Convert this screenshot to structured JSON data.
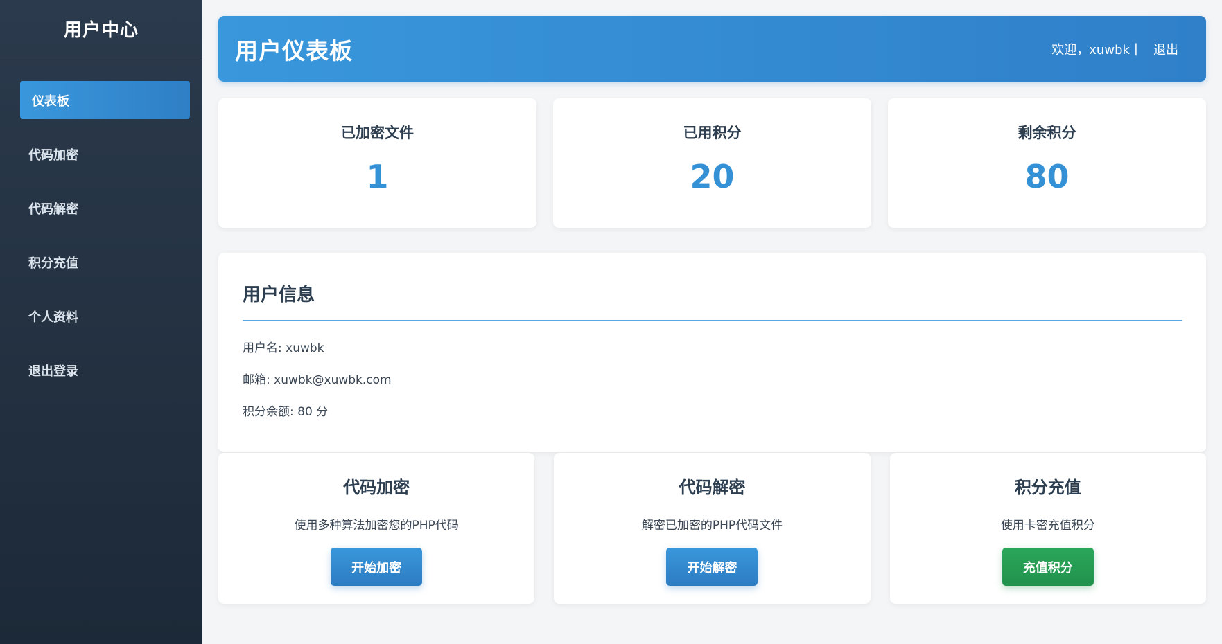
{
  "sidebar": {
    "title": "用户中心",
    "items": [
      {
        "label": "仪表板",
        "active": true
      },
      {
        "label": "代码加密"
      },
      {
        "label": "代码解密"
      },
      {
        "label": "积分充值"
      },
      {
        "label": "个人资料"
      },
      {
        "label": "退出登录"
      }
    ]
  },
  "header": {
    "title": "用户仪表板",
    "welcome": "欢迎，xuwbk",
    "separator": "|",
    "logout": "退出"
  },
  "stats": [
    {
      "label": "已加密文件",
      "value": "1"
    },
    {
      "label": "已用积分",
      "value": "20"
    },
    {
      "label": "剩余积分",
      "value": "80"
    }
  ],
  "user_info": {
    "title": "用户信息",
    "username": "用户名: xuwbk",
    "email": "邮箱: xuwbk@xuwbk.com",
    "balance": "积分余额: 80 分"
  },
  "actions": [
    {
      "title": "代码加密",
      "desc": "使用多种算法加密您的PHP代码",
      "button": "开始加密"
    },
    {
      "title": "代码解密",
      "desc": "解密已加密的PHP代码文件",
      "button": "开始解密"
    },
    {
      "title": "积分充值",
      "desc": "使用卡密充值积分",
      "button": "充值积分"
    }
  ],
  "colors": {
    "accent": "#3491d6",
    "success": "#22914c",
    "sidebar_bg": "#1c2938"
  }
}
